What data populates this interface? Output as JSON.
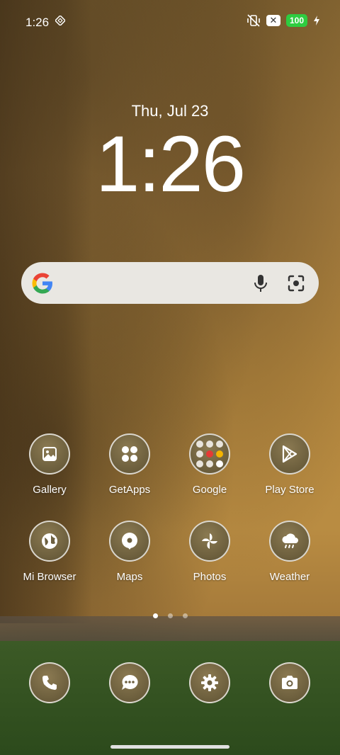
{
  "status_bar": {
    "time": "1:26",
    "battery": "100",
    "icons": [
      "nfc-icon",
      "vibrate-off-icon",
      "close-badge-icon",
      "battery-icon",
      "charging-bolt-icon"
    ]
  },
  "clock": {
    "date": "Thu, Jul 23",
    "time": "1:26"
  },
  "search": {
    "icons": [
      "google-logo-icon",
      "mic-icon",
      "lens-icon"
    ]
  },
  "apps_row1": [
    {
      "label": "Gallery",
      "icon": "gallery-icon"
    },
    {
      "label": "GetApps",
      "icon": "getapps-icon"
    },
    {
      "label": "Google",
      "icon": "google-folder-icon"
    },
    {
      "label": "Play Store",
      "icon": "play-store-icon"
    }
  ],
  "apps_row2": [
    {
      "label": "Mi Browser",
      "icon": "browser-icon"
    },
    {
      "label": "Maps",
      "icon": "maps-icon"
    },
    {
      "label": "Photos",
      "icon": "photos-icon"
    },
    {
      "label": "Weather",
      "icon": "weather-icon"
    }
  ],
  "dock": [
    {
      "name": "phone",
      "icon": "phone-icon"
    },
    {
      "name": "messages",
      "icon": "messages-icon"
    },
    {
      "name": "settings",
      "icon": "settings-icon"
    },
    {
      "name": "camera",
      "icon": "camera-icon"
    }
  ],
  "pages": {
    "count": 3,
    "active": 1
  },
  "colors": {
    "battery": "#2ecc40",
    "icon_bg": "#6d6040"
  }
}
